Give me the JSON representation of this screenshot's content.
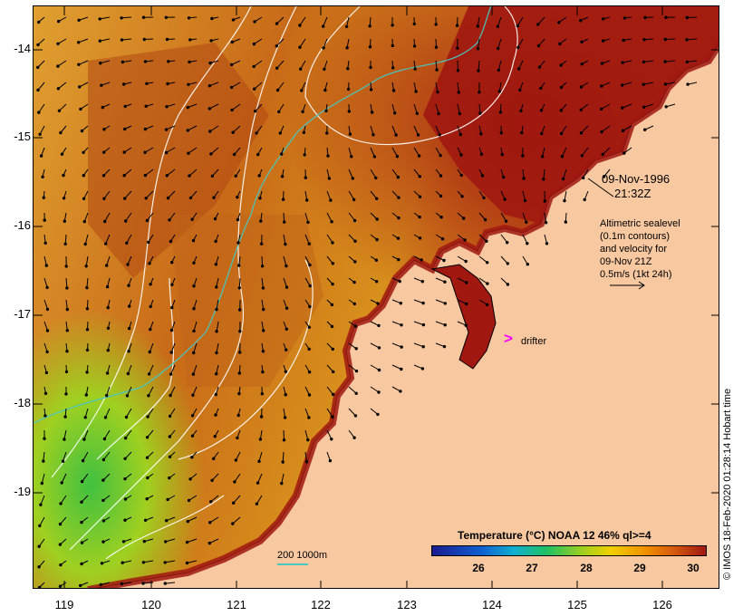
{
  "map": {
    "lat_ticks": [
      "-14",
      "-15",
      "-16",
      "-17",
      "-18",
      "-19"
    ],
    "lon_ticks": [
      "119",
      "120",
      "121",
      "122",
      "123",
      "124",
      "125",
      "126"
    ],
    "colors": {
      "land": "#f8c8a0",
      "warm_sea": "#a01810",
      "isobath": "#49c6c0",
      "contour": "#ffffff",
      "drifter": "#ff00ff"
    }
  },
  "annotations": {
    "date": "09-Nov-1996",
    "time": "21:32Z",
    "altimetry_lines": [
      "Altimetric sealevel",
      "(0.1m contours)",
      "and velocity for",
      "09-Nov 21Z",
      "0.5m/s (1kt 24h)"
    ],
    "drifter_label": "drifter",
    "drifter_marker": ">"
  },
  "colorbar": {
    "title": "Temperature (°C) NOAA 12 46% ql>=4",
    "ticks": [
      "26",
      "27",
      "28",
      "29",
      "30"
    ],
    "colors": [
      "#1a1a90",
      "#1060d0",
      "#10b0d0",
      "#20c060",
      "#a0d020",
      "#f0d000",
      "#f09000",
      "#d05010",
      "#a01810"
    ]
  },
  "scale": {
    "label": "200  1000m"
  },
  "credit": "© IMOS 18-Feb-2020 01:28:14 Hobart time"
}
